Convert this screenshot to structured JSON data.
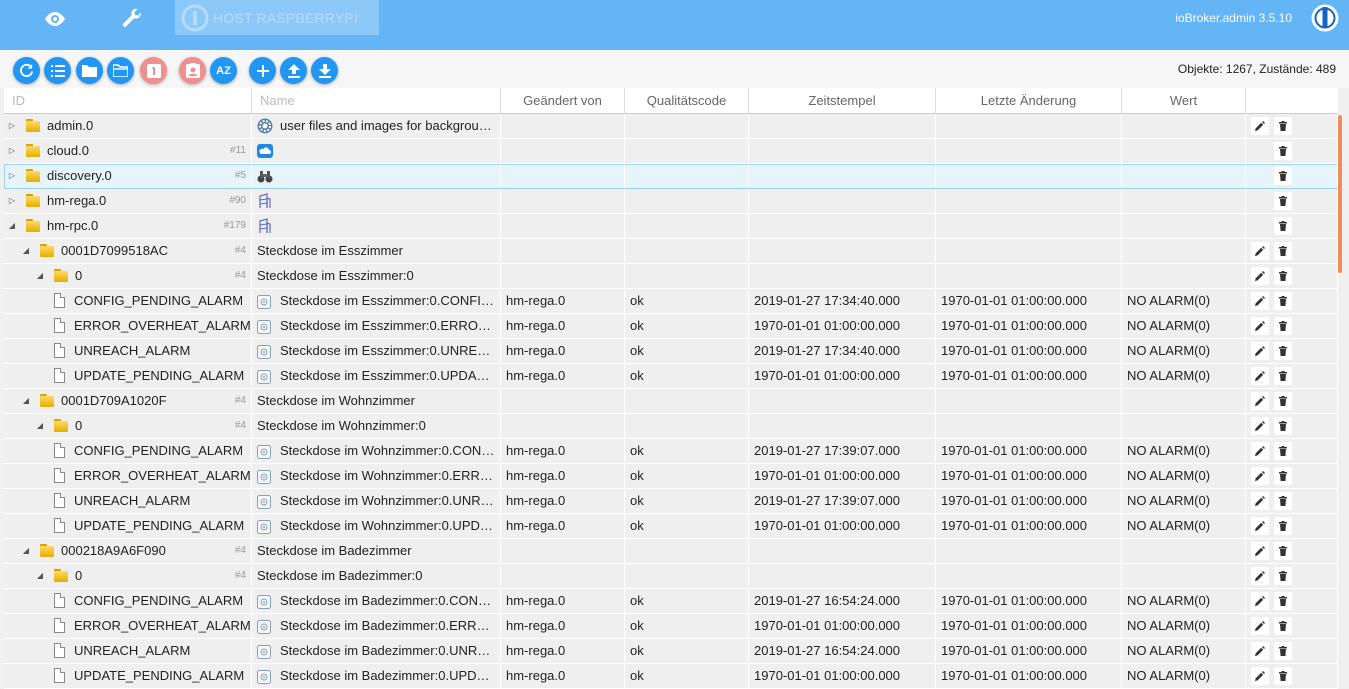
{
  "app": {
    "host_label": "HOST RASPBERRYPI",
    "version": "ioBroker.admin 3.5.10"
  },
  "topbar_icons": [
    "eye-icon",
    "wrench-icon",
    "iobroker-logo-icon"
  ],
  "toolbar": {
    "buttons": [
      {
        "name": "refresh-button",
        "icon": "refresh-icon",
        "color": "#2196f3"
      },
      {
        "name": "list-view-button",
        "icon": "list-icon",
        "color": "#2196f3"
      },
      {
        "name": "collapse-folders-button",
        "icon": "folder-closed-icon",
        "color": "#2196f3"
      },
      {
        "name": "expand-folders-button",
        "icon": "folder-open-icon",
        "color": "#2196f3"
      },
      {
        "name": "toggle-states-button",
        "icon": "badge-one-icon",
        "color": "#ef8f8f"
      },
      {
        "name": "contacts-button",
        "icon": "contact-icon",
        "color": "#ef8f8f"
      },
      {
        "name": "sort-az-button",
        "icon": "sort-az-icon",
        "label": "AZ",
        "color": "#2196f3"
      },
      {
        "name": "add-object-button",
        "icon": "plus-icon",
        "color": "#2196f3"
      },
      {
        "name": "upload-button",
        "icon": "upload-icon",
        "color": "#2196f3"
      },
      {
        "name": "download-button",
        "icon": "download-icon",
        "color": "#2196f3"
      }
    ],
    "counts": "Objekte: 1267, Zustände: 489"
  },
  "columns": {
    "id": "ID",
    "name": "Name",
    "changed_by": "Geändert von",
    "quality": "Qualitätscode",
    "timestamp": "Zeitstempel",
    "last_change": "Letzte Änderung",
    "value": "Wert"
  },
  "rows": [
    {
      "id": "admin.0",
      "level": 0,
      "type": "folder",
      "toggle": "collapsed",
      "count": "",
      "name": "user files and images for backgrou…",
      "name_icon": "admin-gear-icon",
      "changed_by": "",
      "quality": "",
      "ts": "",
      "lc": "",
      "val": "",
      "edit": true
    },
    {
      "id": "cloud.0",
      "level": 0,
      "type": "folder",
      "toggle": "collapsed",
      "count": "#11",
      "name": "",
      "name_icon": "cloud-icon",
      "changed_by": "",
      "quality": "",
      "ts": "",
      "lc": "",
      "val": "",
      "edit": false
    },
    {
      "id": "discovery.0",
      "level": 0,
      "type": "folder",
      "toggle": "collapsed",
      "count": "#5",
      "name": "",
      "name_icon": "binoculars-icon",
      "changed_by": "",
      "quality": "",
      "ts": "",
      "lc": "",
      "val": "",
      "edit": false,
      "selected": true
    },
    {
      "id": "hm-rega.0",
      "level": 0,
      "type": "folder",
      "toggle": "collapsed",
      "count": "#90",
      "name": "",
      "name_icon": "homematic-icon",
      "changed_by": "",
      "quality": "",
      "ts": "",
      "lc": "",
      "val": "",
      "edit": false
    },
    {
      "id": "hm-rpc.0",
      "level": 0,
      "type": "folder",
      "toggle": "expanded",
      "count": "#179",
      "name": "",
      "name_icon": "homematic-icon",
      "changed_by": "",
      "quality": "",
      "ts": "",
      "lc": "",
      "val": "",
      "edit": false
    },
    {
      "id": "0001D7099518AC",
      "level": 1,
      "type": "folder",
      "toggle": "expanded",
      "count": "#4",
      "name": "Steckdose im Esszimmer",
      "name_icon": "",
      "changed_by": "",
      "quality": "",
      "ts": "",
      "lc": "",
      "val": "",
      "edit": true
    },
    {
      "id": "0",
      "level": 2,
      "type": "folder",
      "toggle": "expanded",
      "count": "#4",
      "name": "Steckdose im Esszimmer:0",
      "name_icon": "",
      "changed_by": "",
      "quality": "",
      "ts": "",
      "lc": "",
      "val": "",
      "edit": true
    },
    {
      "id": "CONFIG_PENDING_ALARM",
      "level": 3,
      "type": "state",
      "toggle": "",
      "count": "",
      "name": "Steckdose im Esszimmer:0.CONFI…",
      "name_icon": "state-icon",
      "changed_by": "hm-rega.0",
      "quality": "ok",
      "ts": "2019-01-27 17:34:40.000",
      "lc": "1970-01-01 01:00:00.000",
      "val": "NO ALARM(0)",
      "edit": true
    },
    {
      "id": "ERROR_OVERHEAT_ALARM",
      "level": 3,
      "type": "state",
      "toggle": "",
      "count": "",
      "name": "Steckdose im Esszimmer:0.ERRO…",
      "name_icon": "state-icon",
      "changed_by": "hm-rega.0",
      "quality": "ok",
      "ts": "1970-01-01 01:00:00.000",
      "lc": "1970-01-01 01:00:00.000",
      "val": "NO ALARM(0)",
      "edit": true
    },
    {
      "id": "UNREACH_ALARM",
      "level": 3,
      "type": "state",
      "toggle": "",
      "count": "",
      "name": "Steckdose im Esszimmer:0.UNRE…",
      "name_icon": "state-icon",
      "changed_by": "hm-rega.0",
      "quality": "ok",
      "ts": "2019-01-27 17:34:40.000",
      "lc": "1970-01-01 01:00:00.000",
      "val": "NO ALARM(0)",
      "edit": true
    },
    {
      "id": "UPDATE_PENDING_ALARM",
      "level": 3,
      "type": "state",
      "toggle": "",
      "count": "",
      "name": "Steckdose im Esszimmer:0.UPDA…",
      "name_icon": "state-icon",
      "changed_by": "hm-rega.0",
      "quality": "ok",
      "ts": "1970-01-01 01:00:00.000",
      "lc": "1970-01-01 01:00:00.000",
      "val": "NO ALARM(0)",
      "edit": true
    },
    {
      "id": "0001D709A1020F",
      "level": 1,
      "type": "folder",
      "toggle": "expanded",
      "count": "#4",
      "name": "Steckdose im Wohnzimmer",
      "name_icon": "",
      "changed_by": "",
      "quality": "",
      "ts": "",
      "lc": "",
      "val": "",
      "edit": true
    },
    {
      "id": "0",
      "level": 2,
      "type": "folder",
      "toggle": "expanded",
      "count": "#4",
      "name": "Steckdose im Wohnzimmer:0",
      "name_icon": "",
      "changed_by": "",
      "quality": "",
      "ts": "",
      "lc": "",
      "val": "",
      "edit": true
    },
    {
      "id": "CONFIG_PENDING_ALARM",
      "level": 3,
      "type": "state",
      "toggle": "",
      "count": "",
      "name": "Steckdose im Wohnzimmer:0.CON…",
      "name_icon": "state-icon",
      "changed_by": "hm-rega.0",
      "quality": "ok",
      "ts": "2019-01-27 17:39:07.000",
      "lc": "1970-01-01 01:00:00.000",
      "val": "NO ALARM(0)",
      "edit": true
    },
    {
      "id": "ERROR_OVERHEAT_ALARM",
      "level": 3,
      "type": "state",
      "toggle": "",
      "count": "",
      "name": "Steckdose im Wohnzimmer:0.ERR…",
      "name_icon": "state-icon",
      "changed_by": "hm-rega.0",
      "quality": "ok",
      "ts": "1970-01-01 01:00:00.000",
      "lc": "1970-01-01 01:00:00.000",
      "val": "NO ALARM(0)",
      "edit": true
    },
    {
      "id": "UNREACH_ALARM",
      "level": 3,
      "type": "state",
      "toggle": "",
      "count": "",
      "name": "Steckdose im Wohnzimmer:0.UNR…",
      "name_icon": "state-icon",
      "changed_by": "hm-rega.0",
      "quality": "ok",
      "ts": "2019-01-27 17:39:07.000",
      "lc": "1970-01-01 01:00:00.000",
      "val": "NO ALARM(0)",
      "edit": true
    },
    {
      "id": "UPDATE_PENDING_ALARM",
      "level": 3,
      "type": "state",
      "toggle": "",
      "count": "",
      "name": "Steckdose im Wohnzimmer:0.UPD…",
      "name_icon": "state-icon",
      "changed_by": "hm-rega.0",
      "quality": "ok",
      "ts": "1970-01-01 01:00:00.000",
      "lc": "1970-01-01 01:00:00.000",
      "val": "NO ALARM(0)",
      "edit": true
    },
    {
      "id": "000218A9A6F090",
      "level": 1,
      "type": "folder",
      "toggle": "expanded",
      "count": "#4",
      "name": "Steckdose im Badezimmer",
      "name_icon": "",
      "changed_by": "",
      "quality": "",
      "ts": "",
      "lc": "",
      "val": "",
      "edit": true
    },
    {
      "id": "0",
      "level": 2,
      "type": "folder",
      "toggle": "expanded",
      "count": "#4",
      "name": "Steckdose im Badezimmer:0",
      "name_icon": "",
      "changed_by": "",
      "quality": "",
      "ts": "",
      "lc": "",
      "val": "",
      "edit": true
    },
    {
      "id": "CONFIG_PENDING_ALARM",
      "level": 3,
      "type": "state",
      "toggle": "",
      "count": "",
      "name": "Steckdose im Badezimmer:0.CON…",
      "name_icon": "state-icon",
      "changed_by": "hm-rega.0",
      "quality": "ok",
      "ts": "2019-01-27 16:54:24.000",
      "lc": "1970-01-01 01:00:00.000",
      "val": "NO ALARM(0)",
      "edit": true
    },
    {
      "id": "ERROR_OVERHEAT_ALARM",
      "level": 3,
      "type": "state",
      "toggle": "",
      "count": "",
      "name": "Steckdose im Badezimmer:0.ERR…",
      "name_icon": "state-icon",
      "changed_by": "hm-rega.0",
      "quality": "ok",
      "ts": "1970-01-01 01:00:00.000",
      "lc": "1970-01-01 01:00:00.000",
      "val": "NO ALARM(0)",
      "edit": true
    },
    {
      "id": "UNREACH_ALARM",
      "level": 3,
      "type": "state",
      "toggle": "",
      "count": "",
      "name": "Steckdose im Badezimmer:0.UNR…",
      "name_icon": "state-icon",
      "changed_by": "hm-rega.0",
      "quality": "ok",
      "ts": "2019-01-27 16:54:24.000",
      "lc": "1970-01-01 01:00:00.000",
      "val": "NO ALARM(0)",
      "edit": true
    },
    {
      "id": "UPDATE_PENDING_ALARM",
      "level": 3,
      "type": "state",
      "toggle": "",
      "count": "",
      "name": "Steckdose im Badezimmer:0.UPD…",
      "name_icon": "state-icon",
      "changed_by": "hm-rega.0",
      "quality": "ok",
      "ts": "1970-01-01 01:00:00.000",
      "lc": "1970-01-01 01:00:00.000",
      "val": "NO ALARM(0)",
      "edit": true
    }
  ]
}
